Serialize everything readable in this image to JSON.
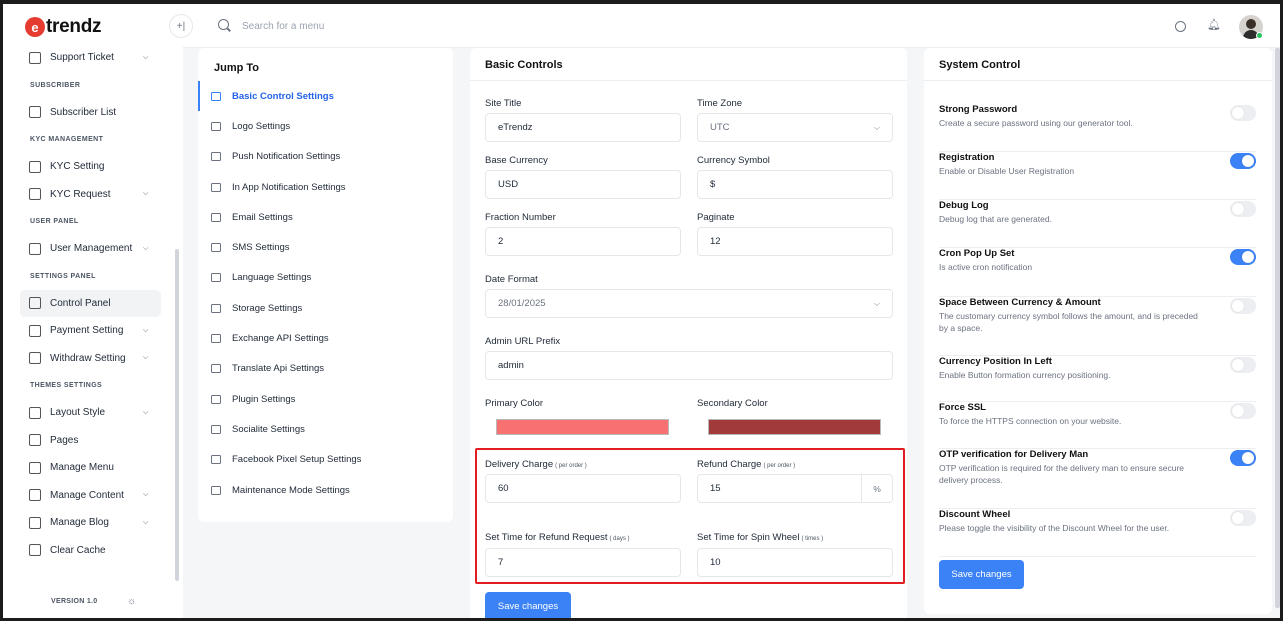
{
  "brand": {
    "letter": "e",
    "name": "trendz"
  },
  "topbar": {
    "collapse_icon": "+|",
    "search_placeholder": "Search for a menu"
  },
  "sidebar": {
    "items": [
      {
        "type": "item",
        "label": "Support Ticket",
        "icon": "support-icon",
        "chevron": true
      },
      {
        "type": "head",
        "label": "SUBSCRIBER"
      },
      {
        "type": "item",
        "label": "Subscriber List",
        "icon": "bell-icon",
        "chevron": false
      },
      {
        "type": "head",
        "label": "KYC MANAGEMENT"
      },
      {
        "type": "item",
        "label": "KYC Setting",
        "icon": "kyc-setting-icon",
        "chevron": false
      },
      {
        "type": "item",
        "label": "KYC Request",
        "icon": "kyc-request-icon",
        "chevron": true
      },
      {
        "type": "head",
        "label": "USER PANEL"
      },
      {
        "type": "item",
        "label": "User Management",
        "icon": "users-icon",
        "chevron": true
      },
      {
        "type": "head",
        "label": "SETTINGS PANEL"
      },
      {
        "type": "item",
        "label": "Control Panel",
        "icon": "gear-icon",
        "chevron": false,
        "active": true
      },
      {
        "type": "item",
        "label": "Payment Setting",
        "icon": "payment-icon",
        "chevron": true
      },
      {
        "type": "item",
        "label": "Withdraw Setting",
        "icon": "withdraw-icon",
        "chevron": true
      },
      {
        "type": "head",
        "label": "THEMES SETTINGS"
      },
      {
        "type": "item",
        "label": "Layout Style",
        "icon": "layout-icon",
        "chevron": true
      },
      {
        "type": "item",
        "label": "Pages",
        "icon": "pages-icon",
        "chevron": false
      },
      {
        "type": "item",
        "label": "Manage Menu",
        "icon": "folder-icon",
        "chevron": false
      },
      {
        "type": "item",
        "label": "Manage Content",
        "icon": "content-icon",
        "chevron": true
      },
      {
        "type": "item",
        "label": "Manage Blog",
        "icon": "blog-icon",
        "chevron": true
      },
      {
        "type": "item",
        "label": "Clear Cache",
        "icon": "clear-cache-icon",
        "chevron": false
      }
    ],
    "version": "VERSION 1.0"
  },
  "jump": {
    "title": "Jump To",
    "items": [
      {
        "label": "Basic Control Settings",
        "icon": "basic-control-icon",
        "active": true
      },
      {
        "label": "Logo Settings",
        "icon": "image-icon"
      },
      {
        "label": "Push Notification Settings",
        "icon": "megaphone-icon"
      },
      {
        "label": "In App Notification Settings",
        "icon": "bell-icon"
      },
      {
        "label": "Email Settings",
        "icon": "email-icon"
      },
      {
        "label": "SMS Settings",
        "icon": "sms-icon"
      },
      {
        "label": "Language Settings",
        "icon": "language-icon"
      },
      {
        "label": "Storage Settings",
        "icon": "storage-icon"
      },
      {
        "label": "Exchange API Settings",
        "icon": "exchange-icon"
      },
      {
        "label": "Translate Api Settings",
        "icon": "translate-icon"
      },
      {
        "label": "Plugin Settings",
        "icon": "plugin-icon"
      },
      {
        "label": "Socialite Settings",
        "icon": "share-icon"
      },
      {
        "label": "Facebook Pixel Setup Settings",
        "icon": "facebook-icon"
      },
      {
        "label": "Maintenance Mode Settings",
        "icon": "maintenance-icon"
      }
    ]
  },
  "basic": {
    "title": "Basic Controls",
    "site_title": {
      "label": "Site Title",
      "value": "eTrendz"
    },
    "time_zone": {
      "label": "Time Zone",
      "value": "UTC"
    },
    "base_currency": {
      "label": "Base Currency",
      "value": "USD"
    },
    "currency_symbol": {
      "label": "Currency Symbol",
      "value": "$"
    },
    "fraction_number": {
      "label": "Fraction Number",
      "value": "2"
    },
    "paginate": {
      "label": "Paginate",
      "value": "12"
    },
    "date_format": {
      "label": "Date Format",
      "value": "28/01/2025"
    },
    "admin_url_prefix": {
      "label": "Admin URL Prefix",
      "value": "admin"
    },
    "primary_color": {
      "label": "Primary Color",
      "value": "#f87171"
    },
    "secondary_color": {
      "label": "Secondary Color",
      "value": "#a13a3a"
    },
    "delivery_charge": {
      "label": "Delivery Charge",
      "hint": "( per order )",
      "value": "60"
    },
    "refund_charge": {
      "label": "Refund Charge",
      "hint": "( per order )",
      "value": "15",
      "suffix": "%"
    },
    "refund_time": {
      "label": "Set Time for Refund Request",
      "hint": "( days )",
      "value": "7"
    },
    "spin_time": {
      "label": "Set Time for Spin Wheel",
      "hint": "( times )",
      "value": "10"
    },
    "save_label": "Save changes"
  },
  "system": {
    "title": "System Control",
    "rows": [
      {
        "title": "Strong Password",
        "desc": "Create a secure password using our generator tool.",
        "on": false
      },
      {
        "title": "Registration",
        "desc": "Enable or Disable User Registration",
        "on": true
      },
      {
        "title": "Debug Log",
        "desc": "Debug log that are generated.",
        "on": false
      },
      {
        "title": "Cron Pop Up Set",
        "desc": "Is active cron notification",
        "on": true
      },
      {
        "title": "Space Between Currency & Amount",
        "desc": "The customary currency symbol follows the amount, and is preceded by a space.",
        "on": false
      },
      {
        "title": "Currency Position In Left",
        "desc": "Enable Button formation currency positioning.",
        "on": false
      },
      {
        "title": "Force SSL",
        "desc": "To force the HTTPS connection on your website.",
        "on": false
      },
      {
        "title": "OTP verification for Delivery Man",
        "desc": "OTP verification is required for the delivery man to ensure secure delivery process.",
        "on": true
      },
      {
        "title": "Discount Wheel",
        "desc": "Please toggle the visibility of the Discount Wheel for the user.",
        "on": false
      }
    ],
    "save_label": "Save changes"
  },
  "colors": {
    "accent": "#3b82f6",
    "highlight_border": "#e11d22",
    "brand_red": "#e63b30"
  }
}
